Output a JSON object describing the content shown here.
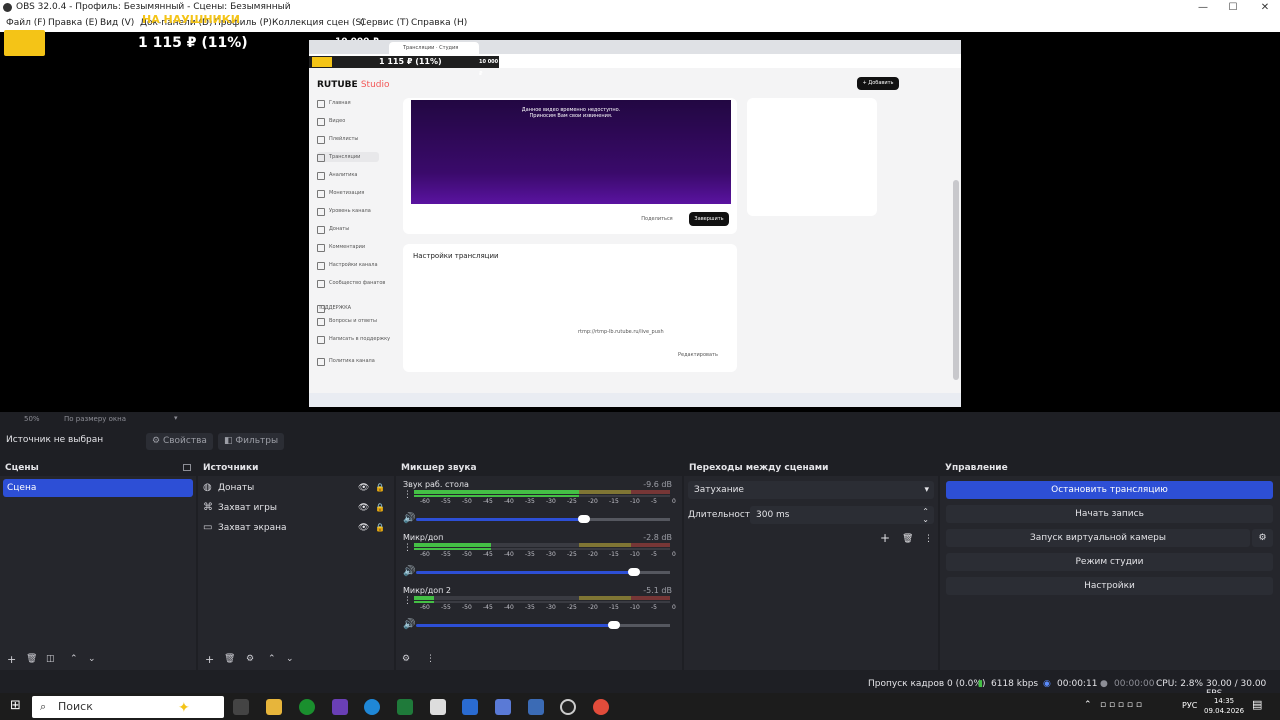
{
  "window": {
    "title": "OBS 32.0.4 - Профиль: Безымянный - Сцены: Безымянный",
    "minimize": "—",
    "maximize": "☐",
    "close": "✕"
  },
  "menu": [
    "Файл (F)",
    "Правка (E)",
    "Вид (V)",
    "Док-панели (D)",
    "Профиль (P)",
    "Коллекция сцен (S)",
    "Сервис (T)",
    "Справка (H)"
  ],
  "preview": {
    "donation_label": "НА НАУШНИКИ",
    "donation_amount": "1 115 ₽ (11%)",
    "donation_goal": "10 000 ₽",
    "capture": {
      "tab_title": "Трансляции · Студия RUTUBE",
      "mini_amount": "1 115 ₽ (11%)",
      "mini_goal": "10 000 ₽",
      "logo": "RUTUBE",
      "logo_suffix": "Studio",
      "add_button": "+ Добавить",
      "sidebar": [
        "Главная",
        "Видео",
        "Плейлисты",
        "Трансляции",
        "Аналитика",
        "Монетизация",
        "Уровень канала",
        "Донаты",
        "Комментарии",
        "Настройки канала",
        "Сообщество фанатов"
      ],
      "sidebar_bottom": [
        "ПОДДЕРЖКА",
        "Вопросы и ответы",
        "Написать в поддержку",
        "Политика канала"
      ],
      "video_msg_1": "Данное видео временно недоступно.",
      "video_msg_2": "Приносим Вам свои извинения.",
      "share_button": "Поделиться",
      "end_button": "Завершить",
      "settings_title": "Настройки трансляции",
      "stream_key_button": "Редактировать",
      "rtmp_url": "rtmp://rtmp-lb.rutube.ru/live_push"
    }
  },
  "zoom": {
    "level": "50%",
    "fit": "По размеру окна"
  },
  "source_toolbar": {
    "no_source": "Источник не выбран",
    "properties": "Свойства",
    "filters": "Фильтры"
  },
  "scenes": {
    "title": "Сцены",
    "items": [
      "Сцена"
    ]
  },
  "sources": {
    "title": "Источники",
    "items": [
      {
        "name": "Донаты",
        "icon": "globe-icon"
      },
      {
        "name": "Захват игры",
        "icon": "gamepad-icon"
      },
      {
        "name": "Захват экрана",
        "icon": "monitor-icon"
      }
    ]
  },
  "mixer": {
    "title": "Микшер звука",
    "ticks": [
      "-60",
      "-55",
      "-50",
      "-45",
      "-40",
      "-35",
      "-30",
      "-25",
      "-20",
      "-15",
      "-10",
      "-5",
      "0"
    ],
    "channels": [
      {
        "name": "Звук раб. стола",
        "db": "-9.6 dB",
        "level": 0.68,
        "volume": 0.66
      },
      {
        "name": "Микр/доп",
        "db": "-2.8 dB",
        "level": 0.3,
        "volume": 0.86
      },
      {
        "name": "Микр/доп 2",
        "db": "-5.1 dB",
        "level": 0.08,
        "volume": 0.78
      }
    ]
  },
  "transitions": {
    "title": "Переходы между сценами",
    "selected": "Затухание",
    "duration_label": "Длительность",
    "duration_value": "300 ms"
  },
  "controls": {
    "title": "Управление",
    "stop_stream": "Остановить трансляцию",
    "start_record": "Начать запись",
    "virtual_cam": "Запуск виртуальной камеры",
    "studio_mode": "Режим студии",
    "settings": "Настройки"
  },
  "status": {
    "dropped": "Пропуск кадров 0 (0.0%)",
    "bitrate": "6118 kbps",
    "stream_time": "00:00:11",
    "record_time": "00:00:00",
    "cpu": "CPU: 2.8%",
    "fps": "30.00 / 30.00 FPS"
  },
  "taskbar": {
    "search": "Поиск",
    "lang": "РУС",
    "time": "14:35",
    "date": "09.04.2026"
  },
  "colors": {
    "accent": "#2d4fd6",
    "donation_yellow": "#f4c417",
    "meter_green": "#44c045"
  }
}
